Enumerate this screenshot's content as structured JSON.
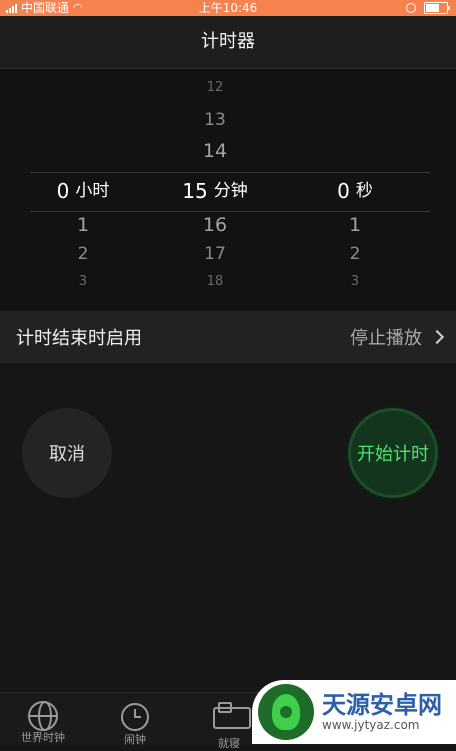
{
  "status": {
    "carrier": "中国联通",
    "time": "上午10:46",
    "battery_level": 0.6
  },
  "nav": {
    "title": "计时器"
  },
  "picker": {
    "hours": {
      "above": [],
      "selected": "0",
      "unit": "小时",
      "below": [
        "1",
        "2",
        "3"
      ]
    },
    "minutes": {
      "above": [
        "12",
        "13",
        "14"
      ],
      "selected": "15",
      "unit": "分钟",
      "below": [
        "16",
        "17",
        "18"
      ]
    },
    "seconds": {
      "above": [],
      "selected": "0",
      "unit": "秒",
      "below": [
        "1",
        "2",
        "3"
      ]
    }
  },
  "when_ends": {
    "label": "计时结束时启用",
    "value": "停止播放"
  },
  "buttons": {
    "cancel": "取消",
    "start": "开始计时"
  },
  "tabs": [
    {
      "label": "世界时钟",
      "icon": "globe-icon"
    },
    {
      "label": "闹钟",
      "icon": "alarm-clock-icon"
    },
    {
      "label": "就寝",
      "icon": "bed-icon"
    }
  ],
  "watermark": {
    "title": "天源安卓网",
    "url": "www.jytyaz.com"
  },
  "colors": {
    "status_bar": "#f5824f",
    "start_green": "#4fe26b",
    "start_bg": "#14351d"
  }
}
